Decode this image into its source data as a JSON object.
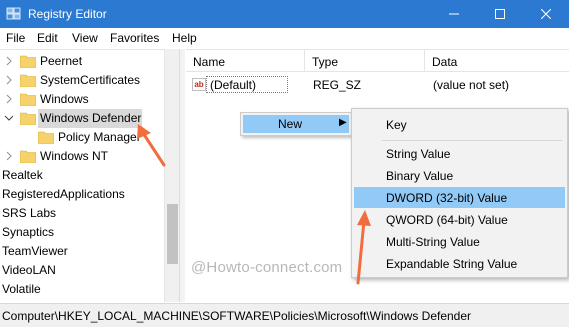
{
  "window": {
    "title": "Registry Editor",
    "icon": "registry-icon",
    "controls": [
      "minimize-icon",
      "maximize-icon",
      "close-icon"
    ]
  },
  "menu": {
    "items": [
      "File",
      "Edit",
      "View",
      "Favorites",
      "Help"
    ]
  },
  "tree": {
    "items": [
      {
        "label": "Peernet",
        "level": 1,
        "expander": "collapsed"
      },
      {
        "label": "SystemCertificates",
        "level": 1,
        "expander": "collapsed"
      },
      {
        "label": "Windows",
        "level": 1,
        "expander": "collapsed"
      },
      {
        "label": "Windows Defender",
        "level": 1,
        "expander": "expanded",
        "selected": true
      },
      {
        "label": "Policy Manager",
        "level": 2,
        "expander": "none"
      },
      {
        "label": "Windows NT",
        "level": 1,
        "expander": "collapsed"
      },
      {
        "label": "Realtek",
        "level": 0,
        "expander": "none"
      },
      {
        "label": "RegisteredApplications",
        "level": 0,
        "expander": "none"
      },
      {
        "label": "SRS Labs",
        "level": 0,
        "expander": "none"
      },
      {
        "label": "Synaptics",
        "level": 0,
        "expander": "none"
      },
      {
        "label": "TeamViewer",
        "level": 0,
        "expander": "none"
      },
      {
        "label": "VideoLAN",
        "level": 0,
        "expander": "none"
      },
      {
        "label": "Volatile",
        "level": 0,
        "expander": "none"
      }
    ]
  },
  "values_pane": {
    "columns": [
      "Name",
      "Type",
      "Data"
    ],
    "rows": [
      {
        "name": "(Default)",
        "type": "REG_SZ",
        "data": "(value not set)",
        "icon": "string-value-icon"
      }
    ]
  },
  "context_menu": {
    "new_label": "New",
    "submenu": {
      "key_label": "Key",
      "items": [
        "String Value",
        "Binary Value",
        "DWORD (32-bit) Value",
        "QWORD (64-bit) Value",
        "Multi-String Value",
        "Expandable String Value"
      ],
      "highlighted": "DWORD (32-bit) Value"
    }
  },
  "status_bar": {
    "path": "Computer\\HKEY_LOCAL_MACHINE\\SOFTWARE\\Policies\\Microsoft\\Windows Defender"
  },
  "watermark": "@Howto-connect.com",
  "colors": {
    "title_bar": "#2b79d0",
    "highlight": "#91c9f7",
    "selection": "#d9d9d9",
    "folder": "#f5d26b",
    "arrow": "#f26d3d"
  }
}
